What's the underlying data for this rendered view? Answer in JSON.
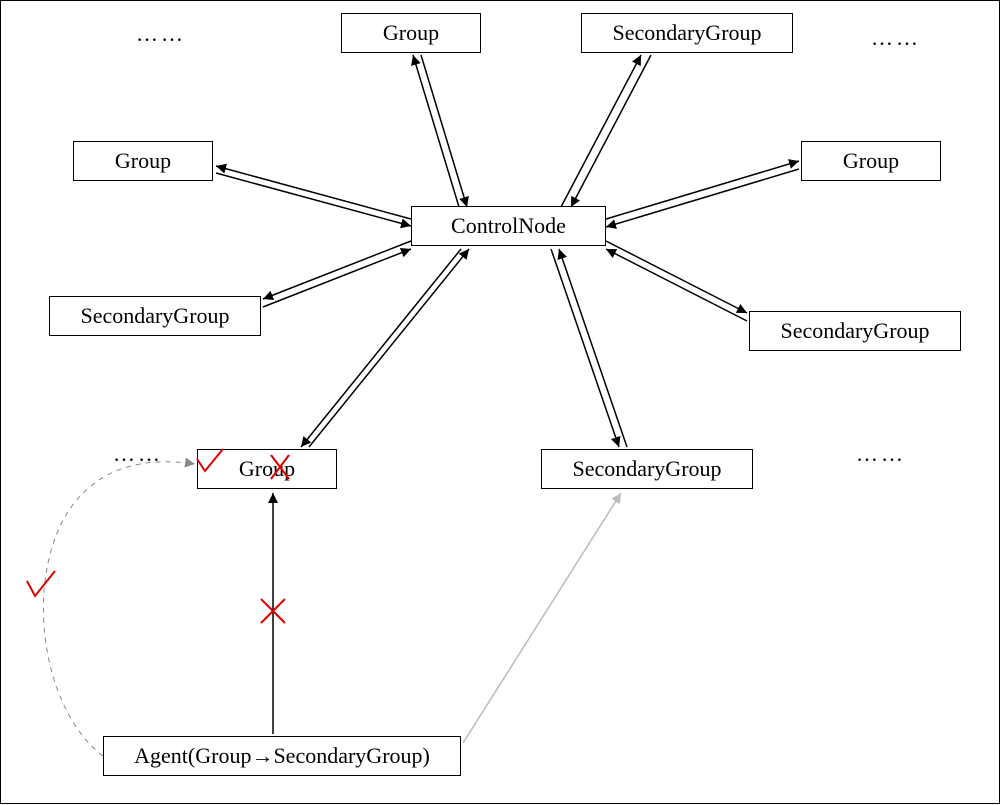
{
  "nodes": {
    "top_group": "Group",
    "top_secondary": "SecondaryGroup",
    "left_group": "Group",
    "right_group": "Group",
    "left_secondary": "SecondaryGroup",
    "right_secondary": "SecondaryGroup",
    "control": "ControlNode",
    "mid_group": "Group",
    "mid_secondary": "SecondaryGroup",
    "agent": "Agent(Group→SecondaryGroup)"
  },
  "decorations": {
    "dots": "……"
  },
  "marks": {
    "check": "√",
    "cross": "×"
  }
}
